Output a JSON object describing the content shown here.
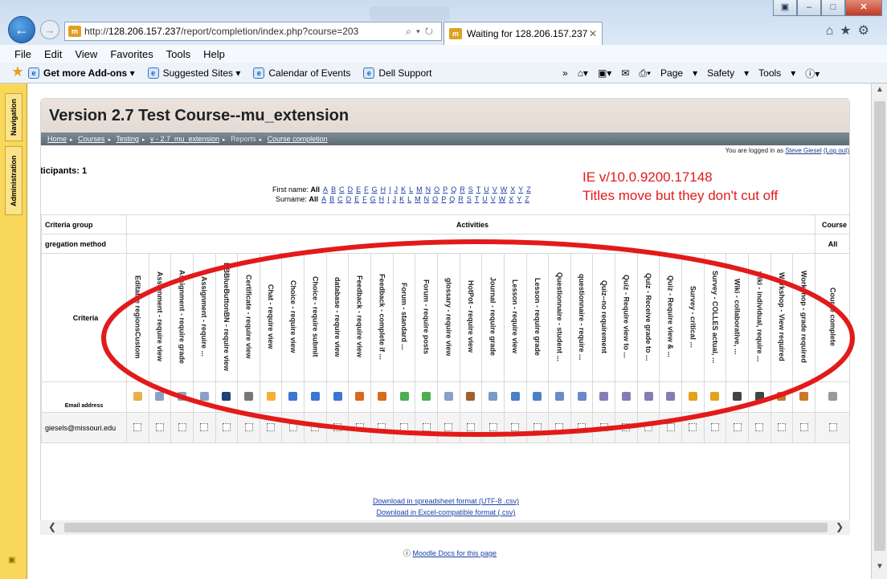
{
  "browser": {
    "url_prefix": "http://",
    "url_host": "128.206.157.237",
    "url_path": "/report/completion/index.php?course=203",
    "tab_title": "Waiting for 128.206.157.237",
    "menu": [
      "File",
      "Edit",
      "View",
      "Favorites",
      "Tools",
      "Help"
    ],
    "favorites": [
      "Get more Add-ons",
      "Suggested Sites",
      "Calendar of Events",
      "Dell Support"
    ],
    "commands": [
      "Page",
      "Safety",
      "Tools"
    ]
  },
  "sidebar": {
    "tabs": [
      "Navigation",
      "Administration"
    ]
  },
  "course": {
    "title": "Version 2.7 Test Course--mu_extension",
    "breadcrumb": [
      "Home",
      "Courses",
      "Testing",
      "v - 2.7_mu_extension",
      "Reports",
      "Course completion"
    ]
  },
  "login": {
    "prefix": "You are logged in as",
    "user": "Steve Giesel",
    "logout": "(Log out)"
  },
  "participants": "ticipants: 1",
  "filters": {
    "first_name_label": "First name:",
    "surname_label": "Surname:",
    "all": "All",
    "letters": [
      "A",
      "B",
      "C",
      "D",
      "E",
      "F",
      "G",
      "H",
      "I",
      "J",
      "K",
      "L",
      "M",
      "N",
      "O",
      "P",
      "Q",
      "R",
      "S",
      "T",
      "U",
      "V",
      "W",
      "X",
      "Y",
      "Z"
    ]
  },
  "annotation": {
    "line1": "IE v/10.0.9200.17148",
    "line2": "Titles move but they don't cut off"
  },
  "table": {
    "criteria_group_label": "Criteria group",
    "activities_label": "Activities",
    "course_label": "Course",
    "aggregation_label": "gregation method",
    "all_label": "All",
    "criteria_label": "Criteria",
    "email_label": "Email address",
    "criteria": [
      "Editable regionsCustom",
      "Assignment - require view",
      "Assignment - require grade",
      "Assignment - require ...",
      "BBBlueButtonBN - require view",
      "Certificate - require view",
      "Chat - require view",
      "Choice - require view",
      "Choice - require submit",
      "database - require view",
      "Feedback - require view",
      "Feedback - complete if ...",
      "Forum - standard ...",
      "Forum - require posts",
      "glossary - require view",
      "HotPot - require view",
      "Journal - require grade",
      "Lesson - require view",
      "Lesson - require grade",
      "Questionnaire - student ...",
      "questionnaire - require ...",
      "Quiz--no requirement",
      "Quiz - Require view to ...",
      "Quiz - Receive grade to ...",
      "Quiz - Require view & ...",
      "Survey - critical ...",
      "Survey - COLLES actual, ...",
      "Wiki - collaborative, ...",
      "wiki - individual, require ...",
      "Workshop - View required",
      "Workshop - grade required",
      "Course complete"
    ],
    "user_email": "giesels@missouri.edu"
  },
  "downloads": [
    "Download in spreadsheet format (UTF-8 .csv)",
    "Download in Excel-compatible format (.csv)"
  ],
  "docs_link": "Moodle Docs for this page",
  "colors": {
    "annotation": "#e31a1a",
    "sidebar": "#f9d75a"
  }
}
